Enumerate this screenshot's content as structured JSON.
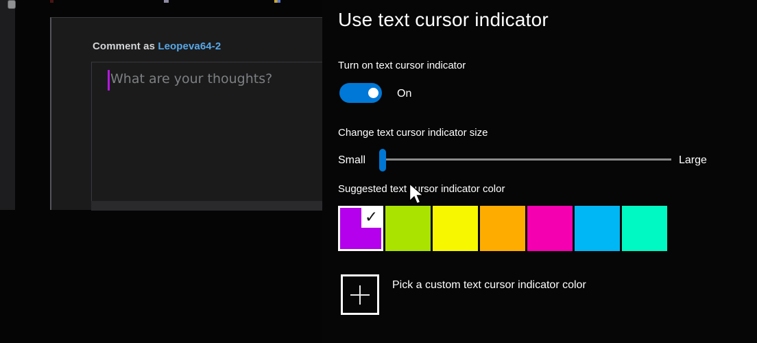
{
  "browser": {
    "comment_box": {
      "comment_as_label": "Comment as",
      "username": "Leopeva64-2",
      "textarea_placeholder": "What are your thoughts?",
      "username_color": "#57a8e8",
      "text_cursor_indicator_color": "#b517dd"
    }
  },
  "settings": {
    "title": "Use text cursor indicator",
    "turn_on": {
      "label": "Turn on text cursor indicator",
      "state_label": "On",
      "enabled": true
    },
    "size": {
      "label": "Change text cursor indicator size",
      "min_label": "Small",
      "max_label": "Large",
      "value_percent": 0
    },
    "suggested": {
      "label": "Suggested text cursor indicator color",
      "selected_index": 0,
      "check_icon": "✓",
      "colors": [
        "#B400EC",
        "#AAE300",
        "#F7F700",
        "#FFAC00",
        "#F500B0",
        "#00B7F5",
        "#00F8C3"
      ]
    },
    "custom": {
      "label": "Pick a custom text cursor indicator color",
      "plus_icon": "plus"
    },
    "accent_color": "#0078D7",
    "slider_track_color": "#8a8a8a"
  }
}
